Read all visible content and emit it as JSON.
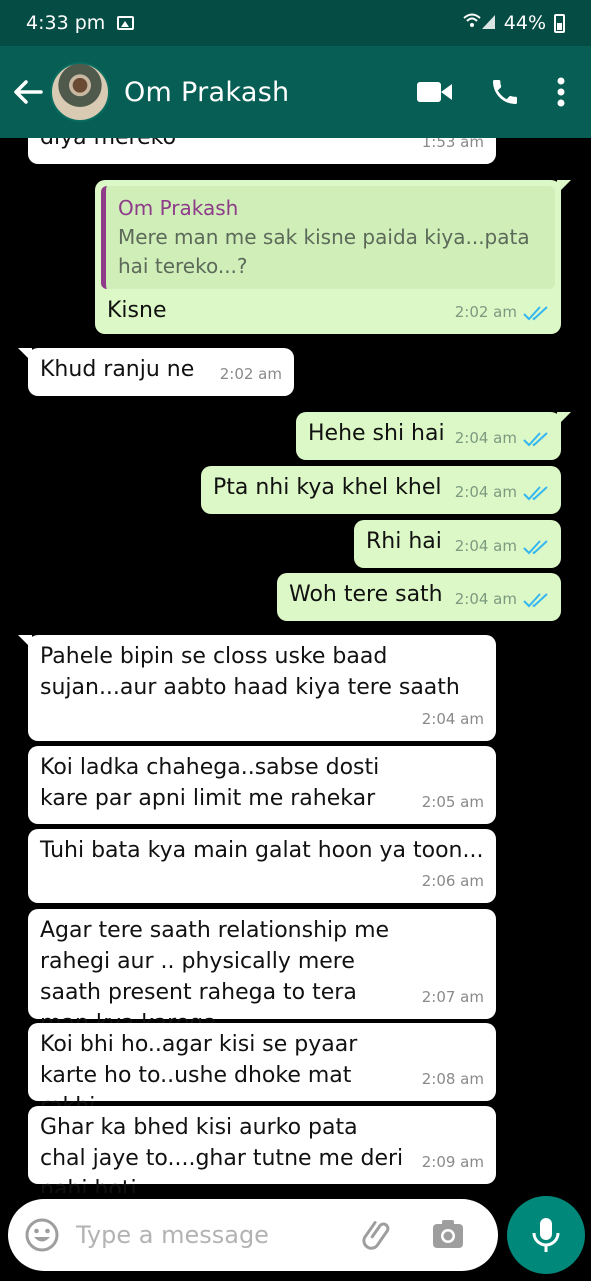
{
  "status_bar": {
    "time": "4:33 pm",
    "battery": "44%"
  },
  "header": {
    "contact_name": "Om Prakash"
  },
  "messages": [
    {
      "dir": "in",
      "text": "diya mereko",
      "time": "1:53 am"
    },
    {
      "dir": "out",
      "quote_name": "Om Prakash",
      "quote_text": "Mere man me sak kisne paida kiya...pata hai tereko...?",
      "text": "Kisne",
      "time": "2:02 am"
    },
    {
      "dir": "in",
      "text": "Khud ranju ne",
      "time": "2:02 am"
    },
    {
      "dir": "out",
      "text": "Hehe shi hai",
      "time": "2:04 am"
    },
    {
      "dir": "out",
      "text": "Pta nhi kya khel khel",
      "time": "2:04 am"
    },
    {
      "dir": "out",
      "text": "Rhi hai",
      "time": "2:04 am"
    },
    {
      "dir": "out",
      "text": "Woh tere sath",
      "time": "2:04 am"
    },
    {
      "dir": "in",
      "text": "Pahele bipin se closs uske baad sujan...aur aabto haad kiya tere saath",
      "time": "2:04 am"
    },
    {
      "dir": "in",
      "text": "Koi ladka chahega..sabse dosti kare par apni limit me rahekar",
      "time": "2:05 am"
    },
    {
      "dir": "in",
      "text": "Tuhi bata kya main galat hoon ya toon...",
      "time": "2:06 am"
    },
    {
      "dir": "in",
      "text": "Agar tere saath relationship me rahegi aur .. physically mere saath present rahega to tera man kya karega",
      "time": "2:07 am"
    },
    {
      "dir": "in",
      "text": "Koi bhi ho..agar kisi se pyaar karte ho to..ushe dhoke mat rakhi",
      "time": "2:08 am"
    },
    {
      "dir": "in",
      "text": "Ghar ka bhed kisi aurko pata chal jaye to....ghar tutne me deri nahi hoti",
      "time": "2:09 am"
    }
  ],
  "composer": {
    "placeholder": "Type a message"
  },
  "colors": {
    "header": "#075e54",
    "status_bar": "#054d44",
    "outgoing": "#dcf8c6",
    "incoming": "#ffffff",
    "tick_read": "#34b7f1",
    "mic": "#00897b"
  }
}
